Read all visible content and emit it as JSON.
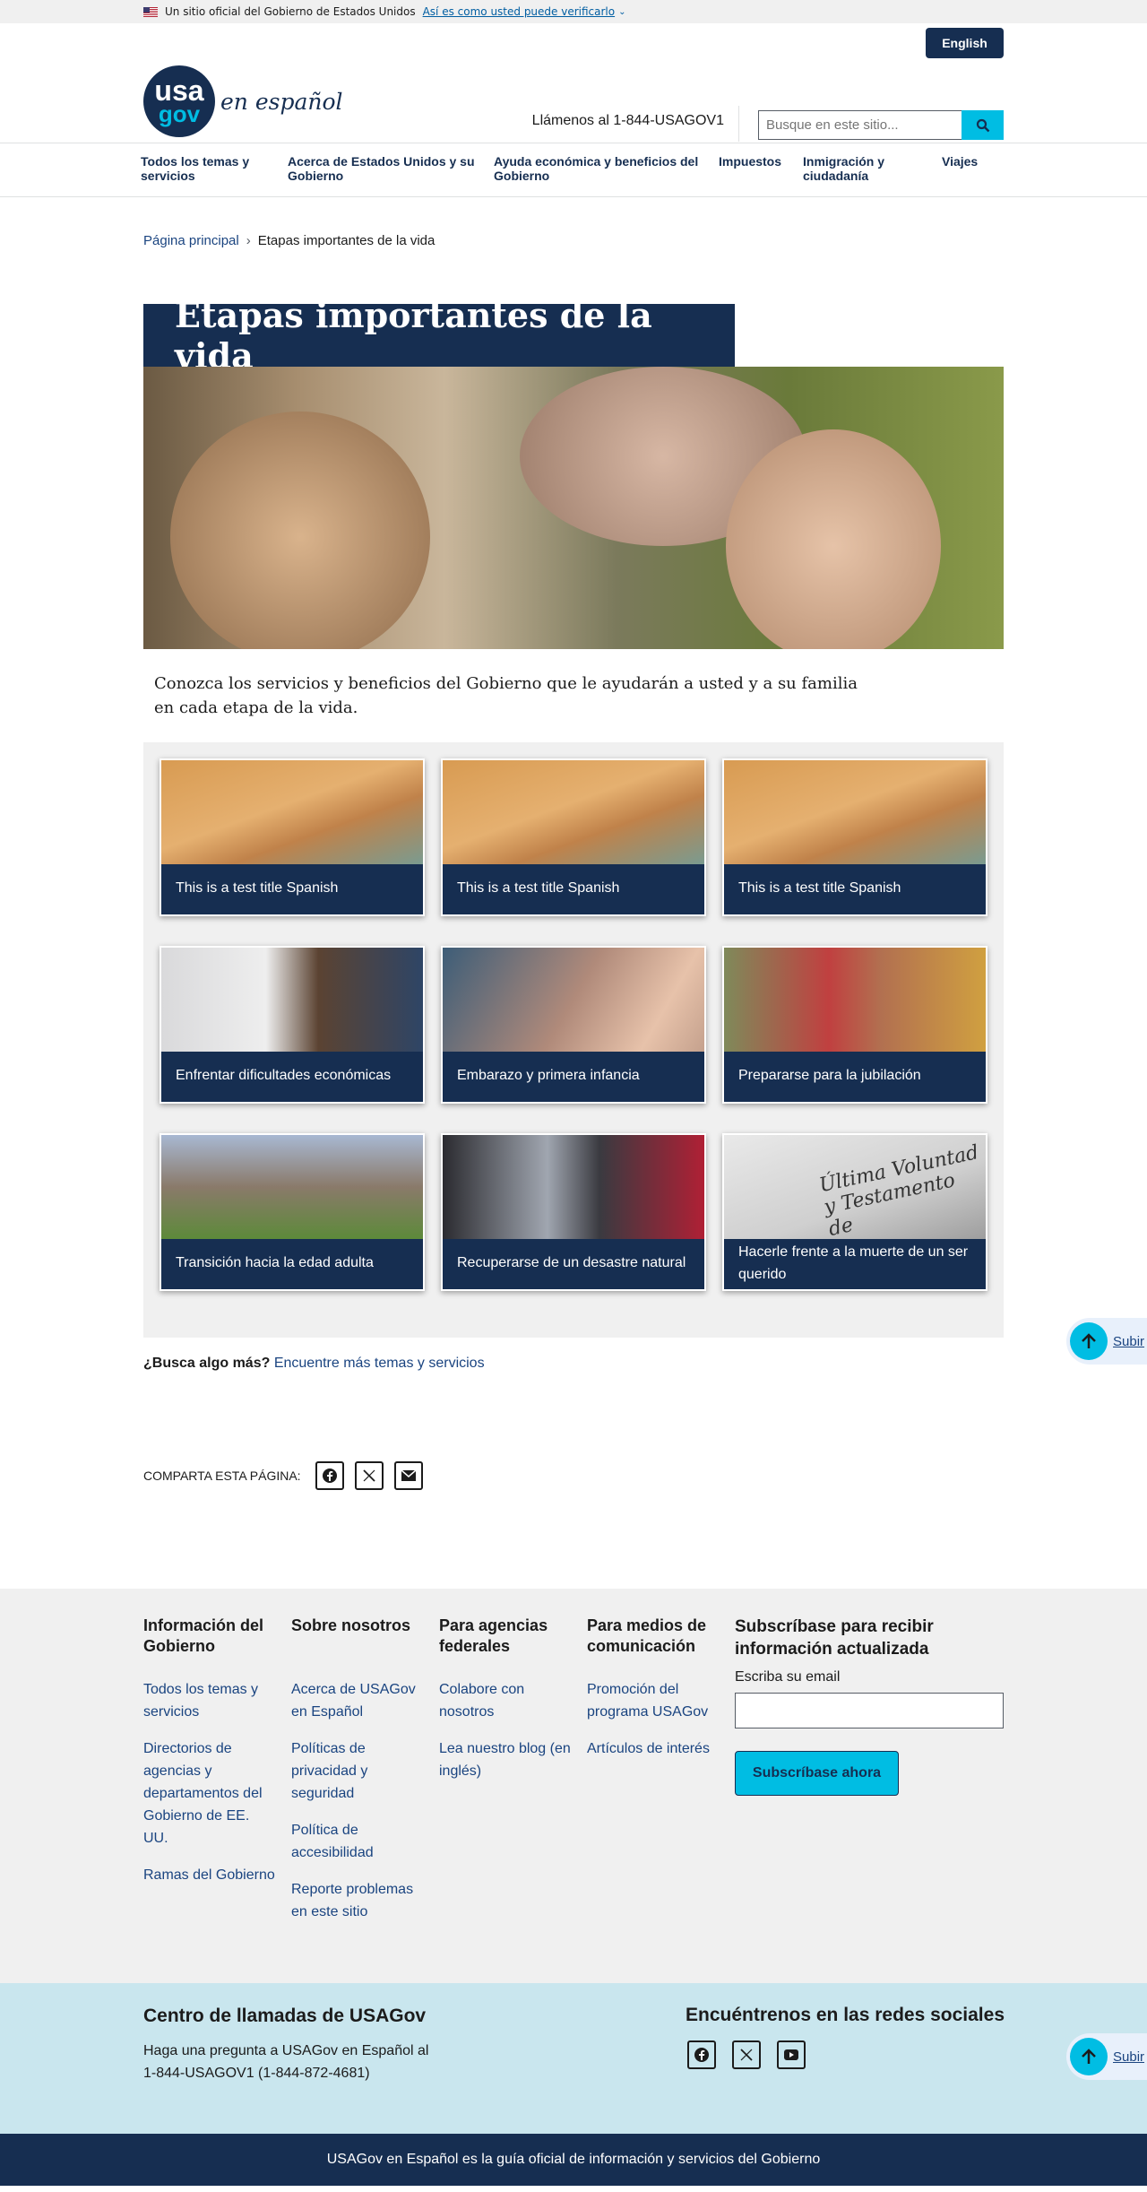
{
  "gov_banner": {
    "text": "Un sitio oficial del Gobierno de Estados Unidos",
    "verify_link": "Así es como usted puede verificarlo"
  },
  "header": {
    "language_button": "English",
    "logo": {
      "line1": "usa",
      "line2": "gov",
      "tagline": "en español"
    },
    "call_text": "Llámenos al 1-844-USAGOV1",
    "search_placeholder": "Busque en este sitio..."
  },
  "nav": [
    "Todos los temas y servicios",
    "Acerca de Estados Unidos y su Gobierno",
    "Ayuda económica y beneficios del Gobierno",
    "Impuestos",
    "Inmigración y ciudadanía",
    "Viajes"
  ],
  "breadcrumb": {
    "home": "Página principal",
    "current": "Etapas importantes de la vida"
  },
  "page_title": "Etapas importantes de la vida",
  "intro": "Conozca los servicios y beneficios del Gobierno que le ayudarán a usted y a su familia en cada etapa de la vida.",
  "cards": [
    "This is a test title Spanish",
    "This is a test title Spanish",
    "This is a test title Spanish",
    "Enfrentar dificultades económicas",
    "Embarazo y primera infancia",
    "Prepararse para la jubilación",
    "Transición hacia la edad adulta",
    "Recuperarse de un desastre natural",
    "Hacerle frente a la muerte de un ser querido"
  ],
  "card_image_text": "Última Voluntad y Testamento de",
  "more": {
    "question": "¿Busca algo más?",
    "link": "Encuentre más temas y servicios"
  },
  "share_label": "COMPARTA ESTA PÁGINA:",
  "back_to_top": "Subir",
  "footer": {
    "col1": {
      "title": "Información del Gobierno",
      "links": [
        "Todos los temas y servicios",
        "Directorios de agencias y departamentos del Gobierno de EE. UU.",
        "Ramas del Gobierno"
      ]
    },
    "col2": {
      "title": "Sobre nosotros",
      "links": [
        "Acerca de USAGov en Español",
        "Políticas de privacidad y seguridad",
        "Política de accesibilidad",
        "Reporte problemas en este sitio"
      ]
    },
    "col3": {
      "title": "Para agencias federales",
      "links": [
        "Colabore con nosotros",
        "Lea nuestro blog (en inglés)"
      ]
    },
    "col4": {
      "title": "Para medios de comunicación",
      "links": [
        "Promoción del programa USAGov",
        "Artículos de interés"
      ]
    },
    "subscribe": {
      "title": "Subscríbase para recibir información actualizada",
      "label": "Escriba su email",
      "button": "Subscríbase ahora"
    }
  },
  "contact": {
    "title": "Centro de llamadas de USAGov",
    "text": "Haga una pregunta a USAGov en Español al 1-844-USAGOV1 (1-844-872-4681)",
    "social_title": "Encuéntrenos en las redes sociales"
  },
  "bottom_bar": "USAGov en Español es la guía oficial de información y servicios del Gobierno",
  "colors": {
    "navy": "#162e51",
    "cyan": "#00bde3",
    "link": "#1a4480",
    "light_blue": "#c9e6ee"
  }
}
